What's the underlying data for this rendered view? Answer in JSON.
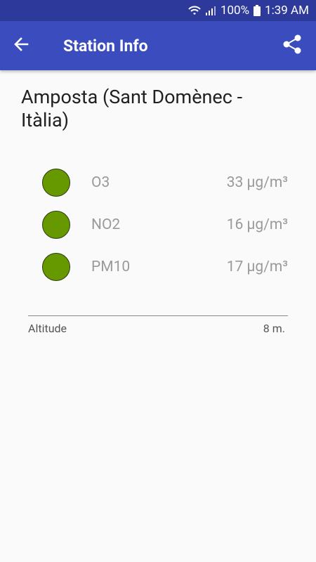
{
  "status_bar": {
    "battery": "100%",
    "time": "1:39 AM"
  },
  "app_bar": {
    "title": "Station Info",
    "back_icon": "arrow-back-icon",
    "share_icon": "share-icon"
  },
  "station": {
    "name": "Amposta (Sant Domènec - Itàlia)"
  },
  "pollutants": [
    {
      "name": "O3",
      "value": "33 µg/m³",
      "color": "#669900"
    },
    {
      "name": "NO2",
      "value": "16 µg/m³",
      "color": "#669900"
    },
    {
      "name": "PM10",
      "value": "17 µg/m³",
      "color": "#669900"
    }
  ],
  "altitude": {
    "label": "Altitude",
    "value": "8 m."
  },
  "colors": {
    "status_bar": "#2d3a9b",
    "app_bar": "#3b4dbe",
    "good_quality": "#669900"
  }
}
